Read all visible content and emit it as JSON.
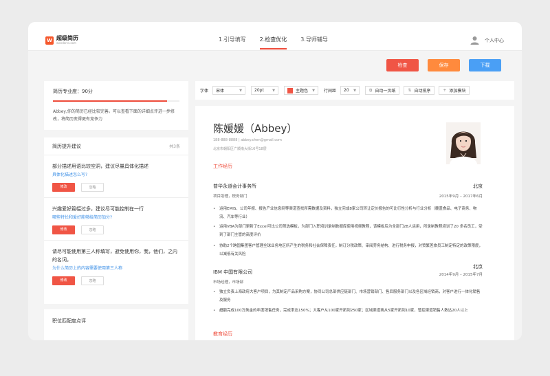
{
  "header": {
    "logo_title": "超级简历",
    "logo_sub": "wondercv.com",
    "steps": [
      {
        "label": "1.引导填写"
      },
      {
        "label": "2.检查优化"
      },
      {
        "label": "3.导师辅导"
      }
    ],
    "active_step": 1,
    "user_label": "个人中心"
  },
  "actions": {
    "check": "检查",
    "save": "保存",
    "download": "下载"
  },
  "score": {
    "title": "简历专业度：90分",
    "value": 90,
    "fill_percent": 90,
    "desc": "Abbey,你的简历已经比较完善。可以查看下面的详细点评进一步修改，将简历变得更有竞争力"
  },
  "suggestions": {
    "title": "简历提升建议",
    "count": "共3条",
    "fix_label": "修改",
    "ignore_label": "忽略",
    "items": [
      {
        "text": "部分描述用语比较空洞，建议尽量具体化描述",
        "link": "具体化描述怎么写?"
      },
      {
        "text": "兴趣爱好篇幅过多，建议尽可能控制在一行",
        "link": "哪些特长和爱好能够给简历加分?"
      },
      {
        "text": "请尽可能使用第三人称填写，避免使用你，我，他们，之内的名词。",
        "link": "为什么简历上的内容需要使用第三人称"
      }
    ]
  },
  "match": {
    "title": "职位匹配度点评"
  },
  "toolbar": {
    "font_label": "字体",
    "font_value": "宋体",
    "size_value": "20pt",
    "theme_label": "主题色",
    "theme_color": "#f05545",
    "line_label": "行间距",
    "line_value": "20",
    "auto_page": "自动一页纸",
    "auto_sort": "自动排序",
    "add_module": "添加模块"
  },
  "resume": {
    "name": "陈媛媛（Abbey）",
    "contact": "188-888-8888 | abbey.chen@gmail.com",
    "address": "北京市朝阳区广顺南大街16号18层",
    "section_work": "工作经历",
    "section_edu": "教育经历",
    "jobs": [
      {
        "company": "普华永道会计事务所",
        "city": "北京",
        "role": "项目助理，税务部门",
        "period": "2015年9月 – 2017年6月",
        "bullets": [
          "运用EMIS、公司年报、报告产业信息网等渠道查找所需数据及资料，独立完成8家公司转让定价报告的可比行性分析与行业分析（覆盖食品、电子商务、物流、汽车等行业）",
          "运用VBA为部门更新了Excel可比公司筛选模板，为部门入职培训录制数据库使用视频教程，该模板后为全部门28人运用，所录制教程培训了20 多名员工，受到了部门主管的高度评价",
          "协助2个跨国集团客户管理全球业务地区所产生的税务和社会保障责任，制订分税政策、审阅劳务结构、进行税务申报，对赞繁差旅员工制定特定的政策限度，以减低有关风险"
        ]
      },
      {
        "company": "IBM 中国有限公司",
        "city": "北京",
        "role": "市场经理，市场部",
        "period": "2014年9月 – 2015年7月",
        "bullets": [
          "独立负责上海政府大客户项目，为其制定产品采购方案，协同公司总部供应链部门、市场营销部门、售后服务部门以及各区域经销商，对客户进行一体化销售及服务",
          "超额完成100万美金的年度销售任务，完成率达150%；大客户从100家开拓到250家；区域渠道商从5家开拓到10家，管控渠道销售人数达20人以上"
        ]
      }
    ]
  }
}
